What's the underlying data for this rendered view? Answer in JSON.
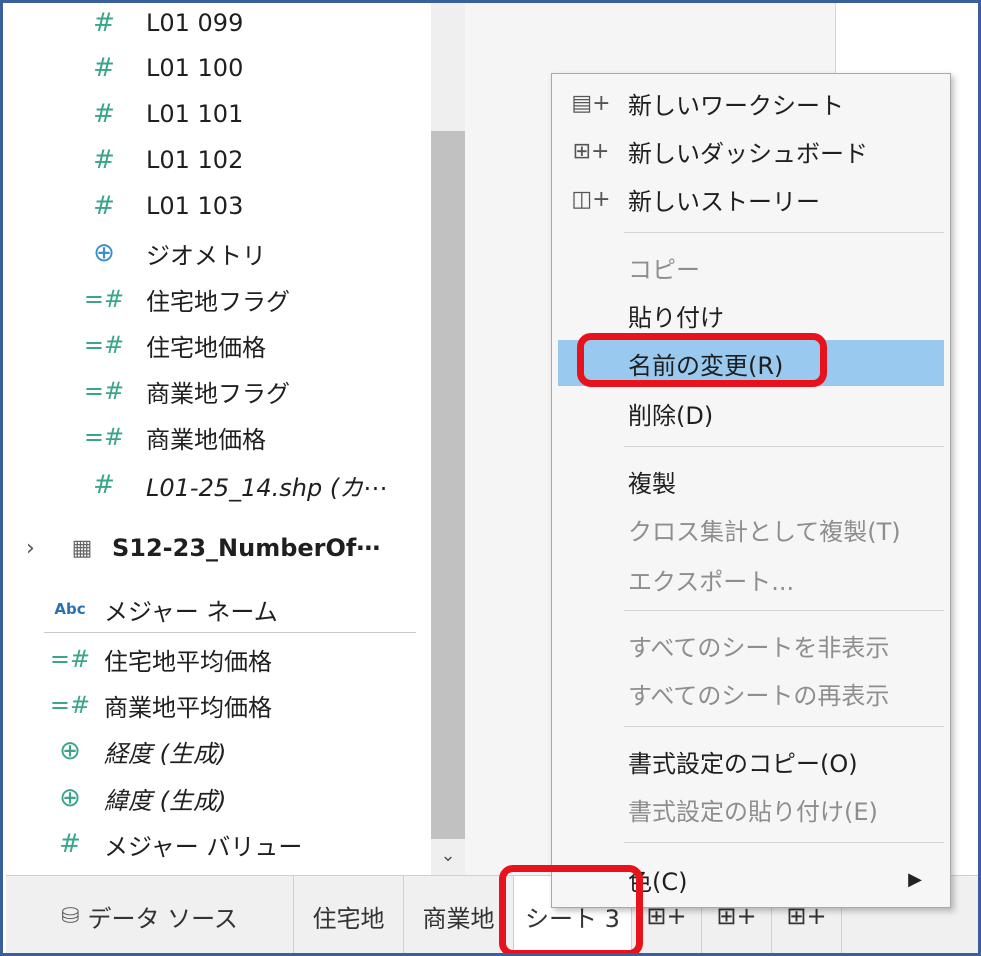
{
  "data_pane": {
    "fields": [
      {
        "icon": "number-icon",
        "glyph": "#",
        "label": "L01 099"
      },
      {
        "icon": "number-icon",
        "glyph": "#",
        "label": "L01 100"
      },
      {
        "icon": "number-icon",
        "glyph": "#",
        "label": "L01 101"
      },
      {
        "icon": "number-icon",
        "glyph": "#",
        "label": "L01 102"
      },
      {
        "icon": "number-icon",
        "glyph": "#",
        "label": "L01 103"
      },
      {
        "icon": "globe-icon",
        "glyph": "🌐",
        "label": "ジオメトリ"
      },
      {
        "icon": "discrete-number-icon",
        "glyph": "=#",
        "label": "住宅地フラグ"
      },
      {
        "icon": "discrete-number-icon",
        "glyph": "=#",
        "label": "住宅地価格"
      },
      {
        "icon": "discrete-number-icon",
        "glyph": "=#",
        "label": "商業地フラグ"
      },
      {
        "icon": "discrete-number-icon",
        "glyph": "=#",
        "label": "商業地価格"
      },
      {
        "icon": "number-icon",
        "glyph": "#",
        "label": "L01-25_14.shp (カ⋯"
      }
    ],
    "datasource": {
      "label": "S12-23_NumberOf⋯"
    },
    "measures": [
      {
        "icon": "abc-icon",
        "glyph": "Abc",
        "label": "メジャー ネーム"
      },
      {
        "icon": "discrete-number-icon",
        "glyph": "=#",
        "label": "住宅地平均価格"
      },
      {
        "icon": "discrete-number-icon",
        "glyph": "=#",
        "label": "商業地平均価格"
      },
      {
        "icon": "globe-icon",
        "glyph": "🌐",
        "label": "経度 (生成)"
      },
      {
        "icon": "globe-icon",
        "glyph": "🌐",
        "label": "緯度 (生成)"
      },
      {
        "icon": "number-icon",
        "glyph": "#",
        "label": "メジャー バリュー"
      }
    ]
  },
  "tabs": {
    "datasource": "データ ソース",
    "sheet1": "住宅地",
    "sheet2": "商業地",
    "sheet3": "シート 3",
    "new_worksheet_glyph": "⊞+",
    "new_dashboard_glyph": "⊞+",
    "new_story_glyph": "⊞+"
  },
  "context_menu": {
    "new_worksheet": "新しいワークシート",
    "new_dashboard": "新しいダッシュボード",
    "new_story": "新しいストーリー",
    "copy": "コピー",
    "paste": "貼り付け",
    "rename": "名前の変更(R)",
    "delete": "削除(D)",
    "duplicate": "複製",
    "duplicate_crosstab": "クロス集計として複製(T)",
    "export": "エクスポート...",
    "hide_all": "すべてのシートを非表示",
    "unhide_all": "すべてのシートの再表示",
    "copy_format": "書式設定のコピー(O)",
    "paste_format": "書式設定の貼り付け(E)",
    "color": "色(C)"
  },
  "colors": {
    "frame": "#3a5f9b",
    "highlight": "#99c9ef",
    "red_callout": "#e8121c",
    "measure_icon": "#3aa58c",
    "disabled_text": "#8e8e8e"
  }
}
